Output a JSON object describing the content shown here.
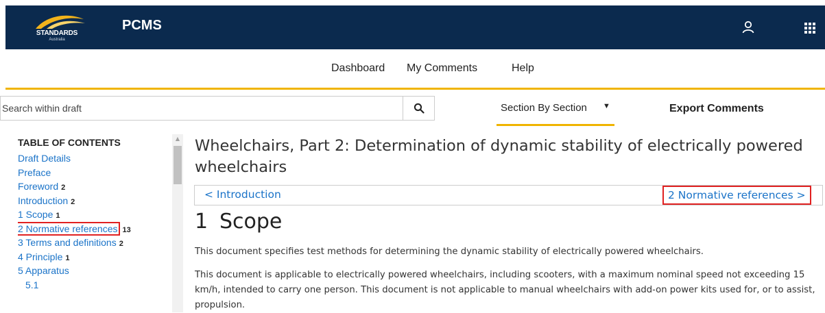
{
  "header": {
    "logo_text": "STANDARDS",
    "logo_subtext": "Australia",
    "app_title": "PCMS",
    "icons": [
      "user-icon",
      "apps-grid-icon"
    ],
    "brand_color": "#0b2a4e",
    "accent_color": "#f0b400"
  },
  "nav": {
    "items": [
      "Dashboard",
      "My Comments",
      "Help"
    ]
  },
  "toolbar": {
    "search_placeholder": "Search within draft",
    "view_label": "Section By Section",
    "export_label": "Export Comments"
  },
  "toc": {
    "title": "TABLE OF CONTENTS",
    "items": [
      {
        "label": "Draft Details",
        "count": ""
      },
      {
        "label": "Preface",
        "count": ""
      },
      {
        "label": "Foreword",
        "count": "2"
      },
      {
        "label": "Introduction",
        "count": "2"
      },
      {
        "label": "1 Scope",
        "count": "1"
      },
      {
        "label": "2 Normative references",
        "count": "13"
      },
      {
        "label": "3 Terms and definitions",
        "count": "2"
      },
      {
        "label": "4 Principle",
        "count": "1"
      },
      {
        "label": "5 Apparatus",
        "count": ""
      },
      {
        "label": "5.1",
        "count": ""
      }
    ]
  },
  "document": {
    "title": "Wheelchairs, Part 2: Determination of dynamic stability of electrically powered wheelchairs",
    "prev_link": "< Introduction",
    "next_link": "2 Normative references >",
    "section_number": "1",
    "section_title": "Scope",
    "paragraphs": [
      "This document specifies test methods for determining the dynamic stability of electrically powered wheelchairs.",
      "This document is applicable to electrically powered wheelchairs, including scooters, with a maximum nominal speed not exceeding 15 km/h, intended to carry one person. This document is not applicable to manual wheelchairs with add-on power kits used for, or to assist, propulsion."
    ]
  }
}
